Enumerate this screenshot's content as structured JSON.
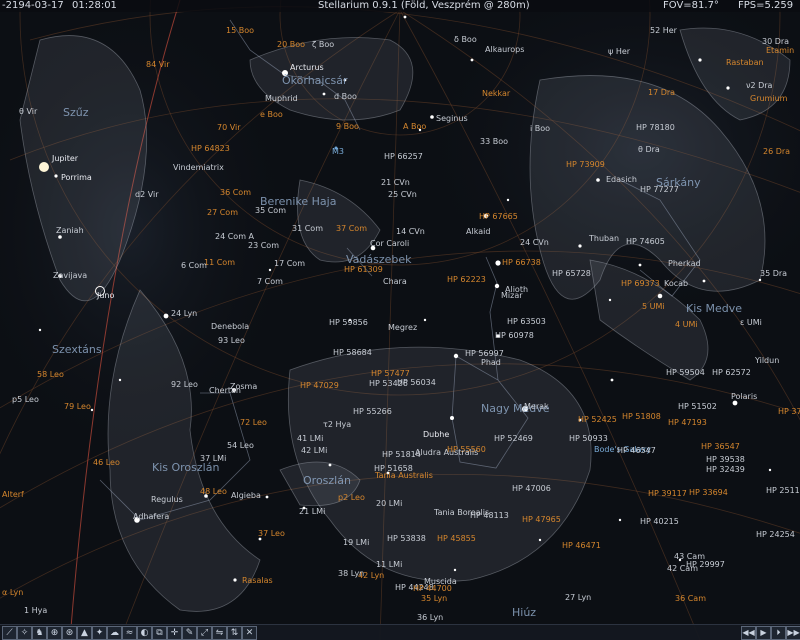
{
  "topbar": {
    "date": "-2194-03-17",
    "time": "01:28:01",
    "location": "Stellarium 0.9.1 (Föld, Veszprém @ 280m)",
    "fov": "FOV=81.7°",
    "fps": "FPS=5.259"
  },
  "colors": {
    "star_label": "#c7ccd4",
    "catalog_label": "#d5862d",
    "constellation_name": "#8ea7c6",
    "nebula_label": "#79aad6",
    "planet_label": "#e8eaf0"
  },
  "labels": [
    {
      "text": "15 Boo",
      "kind": "catalog"
    },
    {
      "text": "20 Boo",
      "kind": "catalog"
    },
    {
      "text": "ζ Boo",
      "kind": "star"
    },
    {
      "text": "Arcturus",
      "kind": "planet"
    },
    {
      "text": "Ökörhajcsár",
      "kind": "constellation"
    },
    {
      "text": "Muphrid",
      "kind": "star"
    },
    {
      "text": "d Boo",
      "kind": "star"
    },
    {
      "text": "e Boo",
      "kind": "catalog"
    },
    {
      "text": "9 Boo",
      "kind": "catalog"
    },
    {
      "text": "M3",
      "kind": "nebula"
    },
    {
      "text": "A Boo",
      "kind": "catalog"
    },
    {
      "text": "Seginus",
      "kind": "star"
    },
    {
      "text": "i Boo",
      "kind": "star"
    },
    {
      "text": "33 Boo",
      "kind": "star"
    },
    {
      "text": "δ Boo",
      "kind": "star"
    },
    {
      "text": "Alkaurops",
      "kind": "star"
    },
    {
      "text": "Nekkar",
      "kind": "catalog"
    },
    {
      "text": "ψ Her",
      "kind": "star"
    },
    {
      "text": "52 Her",
      "kind": "star"
    },
    {
      "text": "30 Dra",
      "kind": "star"
    },
    {
      "text": "Etamin",
      "kind": "catalog"
    },
    {
      "text": "Rastaban",
      "kind": "catalog"
    },
    {
      "text": "ν2 Dra",
      "kind": "star"
    },
    {
      "text": "Grumium",
      "kind": "catalog"
    },
    {
      "text": "17 Dra",
      "kind": "catalog"
    },
    {
      "text": "HP 78180",
      "kind": "star"
    },
    {
      "text": "26 Dra",
      "kind": "catalog"
    },
    {
      "text": "θ Dra",
      "kind": "star"
    },
    {
      "text": "HP 73909",
      "kind": "catalog"
    },
    {
      "text": "Edasich",
      "kind": "star"
    },
    {
      "text": "HP 77277",
      "kind": "star"
    },
    {
      "text": "Sárkány",
      "kind": "constellation"
    },
    {
      "text": "HP 74605",
      "kind": "star"
    },
    {
      "text": "Thuban",
      "kind": "star"
    },
    {
      "text": "HP 65728",
      "kind": "star"
    },
    {
      "text": "HP 69373",
      "kind": "catalog"
    },
    {
      "text": "Pherkad",
      "kind": "star"
    },
    {
      "text": "Kocab",
      "kind": "star"
    },
    {
      "text": "Kis Medve",
      "kind": "constellation"
    },
    {
      "text": "35 Dra",
      "kind": "star"
    },
    {
      "text": "5 UMi",
      "kind": "catalog"
    },
    {
      "text": "4 UMi",
      "kind": "catalog"
    },
    {
      "text": "ε UMi",
      "kind": "star"
    },
    {
      "text": "Yildun",
      "kind": "star"
    },
    {
      "text": "HP 59504",
      "kind": "star"
    },
    {
      "text": "HP 62572",
      "kind": "star"
    },
    {
      "text": "Polaris",
      "kind": "star"
    },
    {
      "text": "HP 37391",
      "kind": "catalog"
    },
    {
      "text": "HP 51502",
      "kind": "star"
    },
    {
      "text": "HP 47193",
      "kind": "catalog"
    },
    {
      "text": "HP 51808",
      "kind": "catalog"
    },
    {
      "text": "HP 52425",
      "kind": "catalog"
    },
    {
      "text": "HP 50933",
      "kind": "star"
    },
    {
      "text": "Bode's Galaxy",
      "kind": "nebula"
    },
    {
      "text": "HP 46547",
      "kind": "star"
    },
    {
      "text": "HP 36547",
      "kind": "catalog"
    },
    {
      "text": "HP 39538",
      "kind": "star"
    },
    {
      "text": "HP 32439",
      "kind": "star"
    },
    {
      "text": "HP 33694",
      "kind": "catalog"
    },
    {
      "text": "HP 39117",
      "kind": "catalog"
    },
    {
      "text": "HP 25110",
      "kind": "star"
    },
    {
      "text": "HP 40215",
      "kind": "star"
    },
    {
      "text": "HP 24254",
      "kind": "star"
    },
    {
      "text": "43 Cam",
      "kind": "star"
    },
    {
      "text": "42 Cam",
      "kind": "star"
    },
    {
      "text": "HP 29997",
      "kind": "star"
    },
    {
      "text": "36 Cam",
      "kind": "catalog"
    },
    {
      "text": "Szűz",
      "kind": "constellation"
    },
    {
      "text": "Jupiter",
      "kind": "planet"
    },
    {
      "text": "Porrima",
      "kind": "planet"
    },
    {
      "text": "Zaniah",
      "kind": "star"
    },
    {
      "text": "Zavijava",
      "kind": "star"
    },
    {
      "text": "Juno",
      "kind": "planet"
    },
    {
      "text": "Vindemiatrix",
      "kind": "star"
    },
    {
      "text": "HP 64823",
      "kind": "catalog"
    },
    {
      "text": "70 Vir",
      "kind": "catalog"
    },
    {
      "text": "84 Vir",
      "kind": "catalog"
    },
    {
      "text": "θ Vir",
      "kind": "star"
    },
    {
      "text": "d2 Vir",
      "kind": "star"
    },
    {
      "text": "Berenike Haja",
      "kind": "constellation"
    },
    {
      "text": "35 Com",
      "kind": "star"
    },
    {
      "text": "27 Com",
      "kind": "catalog"
    },
    {
      "text": "36 Com",
      "kind": "catalog"
    },
    {
      "text": "24 Com A",
      "kind": "star"
    },
    {
      "text": "23 Com",
      "kind": "star"
    },
    {
      "text": "11 Com",
      "kind": "catalog"
    },
    {
      "text": "6 Com",
      "kind": "star"
    },
    {
      "text": "17 Com",
      "kind": "star"
    },
    {
      "text": "7 Com",
      "kind": "star"
    },
    {
      "text": "31 Com",
      "kind": "star"
    },
    {
      "text": "37 Com",
      "kind": "catalog"
    },
    {
      "text": "Vadászebek",
      "kind": "constellation"
    },
    {
      "text": "Cor Caroli",
      "kind": "star"
    },
    {
      "text": "Chara",
      "kind": "star"
    },
    {
      "text": "HP 61309",
      "kind": "catalog"
    },
    {
      "text": "HP 59856",
      "kind": "star"
    },
    {
      "text": "HP 62223",
      "kind": "catalog"
    },
    {
      "text": "14 CVn",
      "kind": "star"
    },
    {
      "text": "21 CVn",
      "kind": "star"
    },
    {
      "text": "25 CVn",
      "kind": "star"
    },
    {
      "text": "HP 66257",
      "kind": "star"
    },
    {
      "text": "HP 67665",
      "kind": "catalog"
    },
    {
      "text": "Alkaid",
      "kind": "star"
    },
    {
      "text": "24 CVn",
      "kind": "star"
    },
    {
      "text": "HP 66738",
      "kind": "catalog"
    },
    {
      "text": "Mizar",
      "kind": "star"
    },
    {
      "text": "Alioth",
      "kind": "star"
    },
    {
      "text": "HP 63503",
      "kind": "star"
    },
    {
      "text": "HP 60978",
      "kind": "star"
    },
    {
      "text": "Megrez",
      "kind": "star"
    },
    {
      "text": "HP 58684",
      "kind": "star"
    },
    {
      "text": "HP 56997",
      "kind": "star"
    },
    {
      "text": "Phad",
      "kind": "star"
    },
    {
      "text": "HP 57477",
      "kind": "catalog"
    },
    {
      "text": "HP 56034",
      "kind": "star"
    },
    {
      "text": "HP 55560",
      "kind": "catalog"
    },
    {
      "text": "Nagy Medve",
      "kind": "constellation"
    },
    {
      "text": "Merak",
      "kind": "star"
    },
    {
      "text": "Dubhe",
      "kind": "planet"
    },
    {
      "text": "HP 52469",
      "kind": "star"
    },
    {
      "text": "HP 51814",
      "kind": "star"
    },
    {
      "text": "HP 51658",
      "kind": "star"
    },
    {
      "text": "Tania Australis",
      "kind": "catalog"
    },
    {
      "text": "Tania Borealis",
      "kind": "star"
    },
    {
      "text": "HP 48113",
      "kind": "star"
    },
    {
      "text": "HP 47006",
      "kind": "star"
    },
    {
      "text": "HP 47965",
      "kind": "catalog"
    },
    {
      "text": "HP 45855",
      "kind": "catalog"
    },
    {
      "text": "HP 46471",
      "kind": "catalog"
    },
    {
      "text": "Muscida",
      "kind": "star"
    },
    {
      "text": "HP 44248",
      "kind": "star"
    },
    {
      "text": "HP 44700",
      "kind": "catalog"
    },
    {
      "text": "36 Lyn",
      "kind": "star"
    },
    {
      "text": "35 Lyn",
      "kind": "catalog"
    },
    {
      "text": "Hiúz",
      "kind": "constellation"
    },
    {
      "text": "27 Lyn",
      "kind": "star"
    },
    {
      "text": "24 Lyn",
      "kind": "star"
    },
    {
      "text": "Denebola",
      "kind": "star"
    },
    {
      "text": "93 Leo",
      "kind": "star"
    },
    {
      "text": "92 Leo",
      "kind": "star"
    },
    {
      "text": "Chertan",
      "kind": "star"
    },
    {
      "text": "Zosma",
      "kind": "star"
    },
    {
      "text": "72 Leo",
      "kind": "catalog"
    },
    {
      "text": "54 Leo",
      "kind": "star"
    },
    {
      "text": "41 LMi",
      "kind": "star"
    },
    {
      "text": "42 LMi",
      "kind": "star"
    },
    {
      "text": "37 LMi",
      "kind": "star"
    },
    {
      "text": "Oroszlán",
      "kind": "constellation"
    },
    {
      "text": "Kis Oroszlán",
      "kind": "constellation"
    },
    {
      "text": "46 Leo",
      "kind": "catalog"
    },
    {
      "text": "48 Leo",
      "kind": "catalog"
    },
    {
      "text": "Algieba",
      "kind": "star"
    },
    {
      "text": "Adhafera",
      "kind": "star"
    },
    {
      "text": "Regulus",
      "kind": "star"
    },
    {
      "text": "37 Leo",
      "kind": "catalog"
    },
    {
      "text": "Rasalas",
      "kind": "catalog"
    },
    {
      "text": "Alterf",
      "kind": "catalog"
    },
    {
      "text": "Szextáns",
      "kind": "constellation"
    },
    {
      "text": "79 Leo",
      "kind": "catalog"
    },
    {
      "text": "58 Leo",
      "kind": "catalog"
    },
    {
      "text": "p5 Leo",
      "kind": "star"
    },
    {
      "text": "p2 Leo",
      "kind": "catalog"
    },
    {
      "text": "21 LMi",
      "kind": "star"
    },
    {
      "text": "20 LMi",
      "kind": "star"
    },
    {
      "text": "19 LMi",
      "kind": "star"
    },
    {
      "text": "11 LMi",
      "kind": "star"
    },
    {
      "text": "42 Lyn",
      "kind": "catalog"
    },
    {
      "text": "38 Lyn",
      "kind": "star"
    },
    {
      "text": "α Lyn",
      "kind": "catalog"
    },
    {
      "text": "1 Hya",
      "kind": "star"
    },
    {
      "text": "τ2 Hya",
      "kind": "star"
    },
    {
      "text": "HP 53426",
      "kind": "star"
    },
    {
      "text": "HP 55266",
      "kind": "star"
    },
    {
      "text": "HP 53838",
      "kind": "star"
    },
    {
      "text": "HP 47029",
      "kind": "catalog"
    },
    {
      "text": "Aludra Australis",
      "kind": "star"
    }
  ]
}
